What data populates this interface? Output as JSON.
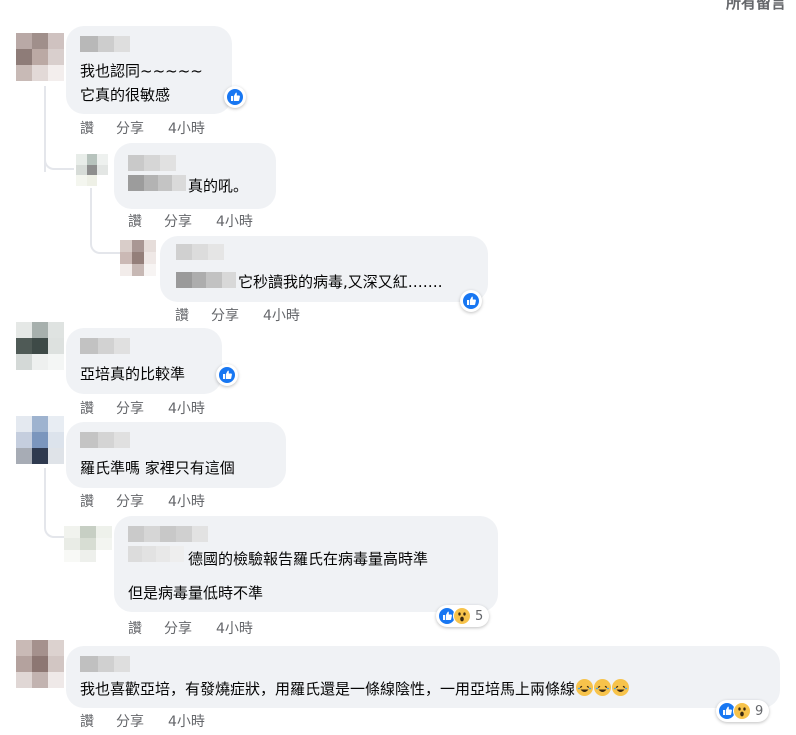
{
  "header": {
    "label": "所有留言"
  },
  "comments": [
    {
      "lines": [
        "我也認同~~~~~",
        "它真的很敏感"
      ],
      "actions": {
        "like": "讚",
        "share": "分享",
        "time": "4小時"
      },
      "reaction": {
        "types": [
          "like"
        ],
        "count": ""
      }
    },
    {
      "lines": [
        "真的吼。"
      ],
      "actions": {
        "like": "讚",
        "share": "分享",
        "time": "4小時"
      }
    },
    {
      "lines": [
        "它秒讀我的病毒,又深又紅……."
      ],
      "actions": {
        "like": "讚",
        "share": "分享",
        "time": "4小時"
      },
      "reaction": {
        "types": [
          "like"
        ],
        "count": ""
      }
    },
    {
      "lines": [
        "亞培真的比較準"
      ],
      "actions": {
        "like": "讚",
        "share": "分享",
        "time": "4小時"
      },
      "reaction": {
        "types": [
          "like"
        ],
        "count": ""
      }
    },
    {
      "lines": [
        "羅氏準嗎 家裡只有這個"
      ],
      "actions": {
        "like": "讚",
        "share": "分享",
        "time": "4小時"
      }
    },
    {
      "lines": [
        "德國的檢驗報告羅氏在病毒量高時準",
        "但是病毒量低時不準"
      ],
      "actions": {
        "like": "讚",
        "share": "分享",
        "time": "4小時"
      },
      "reaction": {
        "types": [
          "like",
          "wow"
        ],
        "count": "5"
      }
    },
    {
      "lines": [
        "我也喜歡亞培，有發燒症狀，用羅氏還是一條線陰性，一用亞培馬上兩條線"
      ],
      "actions": {
        "like": "讚",
        "share": "分享",
        "time": "4小時"
      },
      "reaction": {
        "types": [
          "like",
          "wow"
        ],
        "count": "9"
      },
      "trailing_emoji": [
        "haha",
        "haha",
        "haha"
      ]
    }
  ],
  "colors": {
    "bubble": "#f0f2f5",
    "meta_text": "#65676b",
    "like_blue": "#1877f2",
    "emoji_yellow": "#f7c34b",
    "thread_line": "#e4e6eb"
  }
}
